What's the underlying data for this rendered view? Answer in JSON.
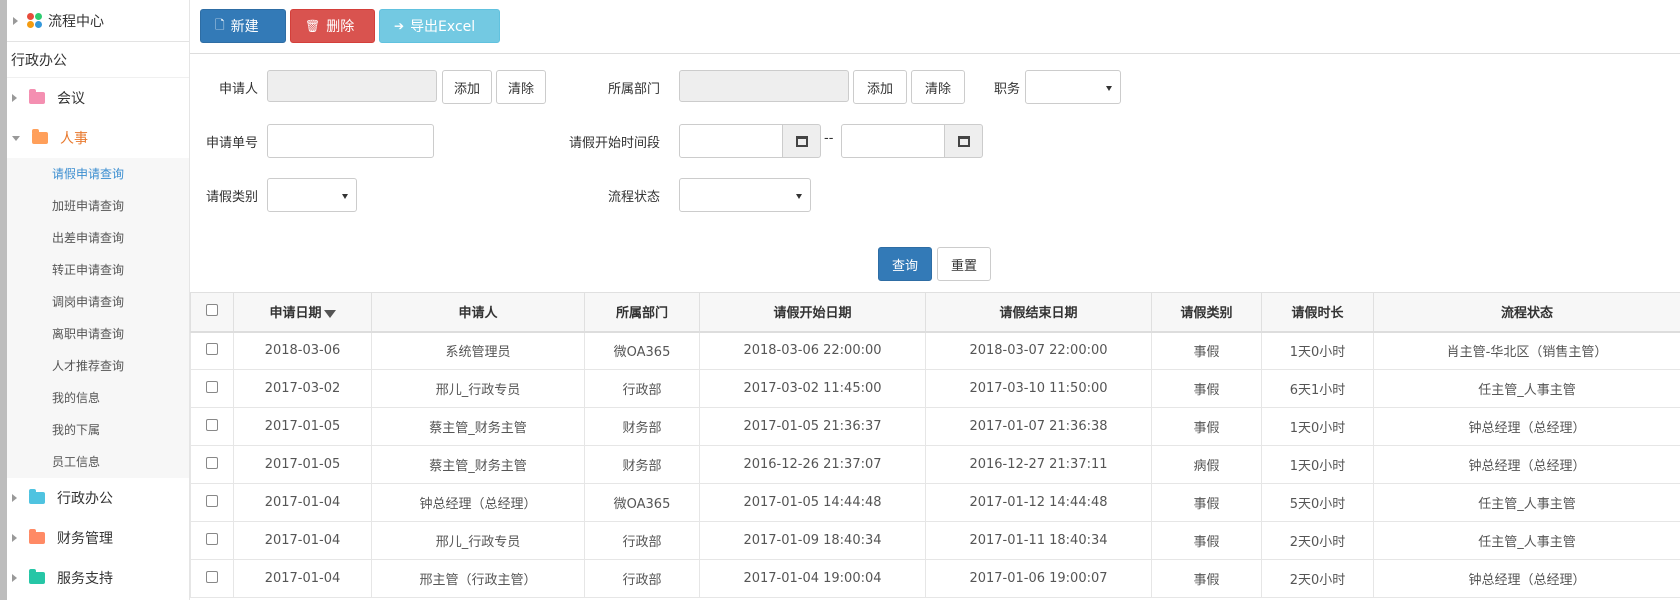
{
  "sidebar": {
    "top_title": "流程中心",
    "section_title": "行政办公",
    "groups_top": [
      {
        "label": "会议",
        "color": "#f48fb1"
      },
      {
        "label": "人事",
        "color": "#ff9f5a"
      }
    ],
    "subitems": [
      "请假申请查询",
      "加班申请查询",
      "出差申请查询",
      "转正申请查询",
      "调岗申请查询",
      "离职申请查询",
      "人才推荐查询",
      "我的信息",
      "我的下属",
      "员工信息"
    ],
    "groups_bottom": [
      {
        "label": "行政办公",
        "color": "#4fc3e0"
      },
      {
        "label": "财务管理",
        "color": "#ff8a65"
      },
      {
        "label": "服务支持",
        "color": "#26c6a6"
      }
    ]
  },
  "toolbar": {
    "new_label": "新建",
    "delete_label": "删除",
    "export_label": "导出Excel"
  },
  "form": {
    "applicant_label": "申请人",
    "add_label": "添加",
    "clear_label": "清除",
    "dept_label": "所属部门",
    "position_label": "职务",
    "request_no_label": "申请单号",
    "leave_start_label": "请假开始时间段",
    "range_sep": "--",
    "leave_type_label": "请假类别",
    "flow_status_label": "流程状态",
    "query_label": "查询",
    "reset_label": "重置"
  },
  "table": {
    "headers": [
      "申请日期",
      "申请人",
      "所属部门",
      "请假开始日期",
      "请假结束日期",
      "请假类别",
      "请假时长",
      "流程状态"
    ],
    "rows": [
      [
        "2018-03-06",
        "系统管理员",
        "微OA365",
        "2018-03-06 22:00:00",
        "2018-03-07 22:00:00",
        "事假",
        "1天0小时",
        "肖主管-华北区（销售主管）"
      ],
      [
        "2017-03-02",
        "邢儿_行政专员",
        "行政部",
        "2017-03-02 11:45:00",
        "2017-03-10 11:50:00",
        "事假",
        "6天1小时",
        "任主管_人事主管"
      ],
      [
        "2017-01-05",
        "蔡主管_财务主管",
        "财务部",
        "2017-01-05 21:36:37",
        "2017-01-07 21:36:38",
        "事假",
        "1天0小时",
        "钟总经理（总经理）"
      ],
      [
        "2017-01-05",
        "蔡主管_财务主管",
        "财务部",
        "2016-12-26 21:37:07",
        "2016-12-27 21:37:11",
        "病假",
        "1天0小时",
        "钟总经理（总经理）"
      ],
      [
        "2017-01-04",
        "钟总经理（总经理）",
        "微OA365",
        "2017-01-05 14:44:48",
        "2017-01-12 14:44:48",
        "事假",
        "5天0小时",
        "任主管_人事主管"
      ],
      [
        "2017-01-04",
        "邢儿_行政专员",
        "行政部",
        "2017-01-09 18:40:34",
        "2017-01-11 18:40:34",
        "事假",
        "2天0小时",
        "任主管_人事主管"
      ],
      [
        "2017-01-04",
        "邢主管（行政主管）",
        "行政部",
        "2017-01-04 19:00:04",
        "2017-01-06 19:00:07",
        "事假",
        "2天0小时",
        "钟总经理（总经理）"
      ]
    ]
  }
}
